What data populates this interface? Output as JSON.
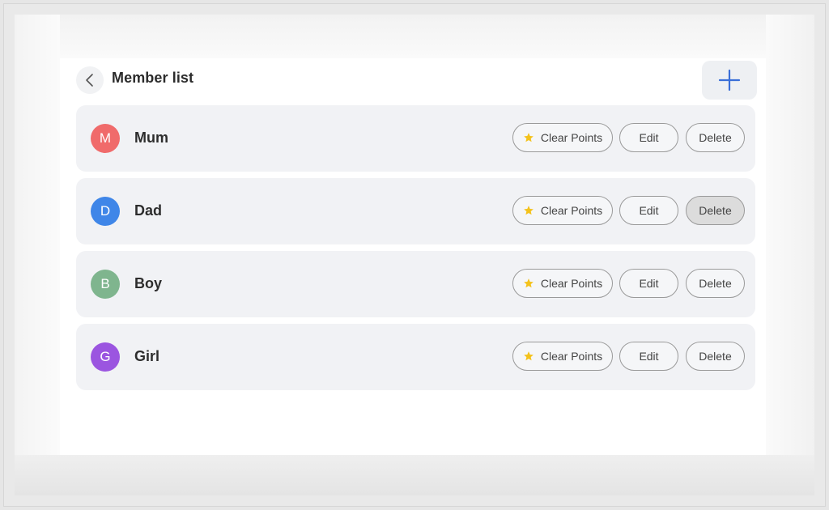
{
  "header": {
    "title": "Member list"
  },
  "members": [
    {
      "initial": "M",
      "name": "Mum",
      "color": "#f06b6b"
    },
    {
      "initial": "D",
      "name": "Dad",
      "color": "#3f86e8"
    },
    {
      "initial": "B",
      "name": "Boy",
      "color": "#7fb58e"
    },
    {
      "initial": "G",
      "name": "Girl",
      "color": "#9b55e0"
    }
  ],
  "actions": {
    "clear_points_label": "Clear Points",
    "edit_label": "Edit",
    "delete_label": "Delete"
  },
  "icons": {
    "back": "chevron-left-icon",
    "add": "plus-icon",
    "clear_points": "star-icon"
  },
  "colors": {
    "accent": "#3a6fd8",
    "star": "#f4c21b"
  }
}
